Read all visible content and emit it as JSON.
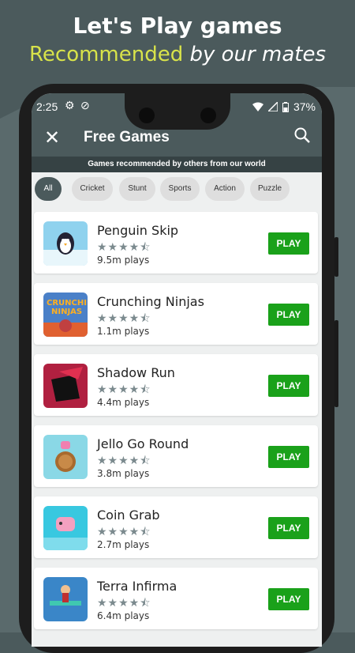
{
  "promo": {
    "line1": "Let's Play games",
    "line2_part1": "Recommended",
    "line2_part2": " by our mates"
  },
  "status_bar": {
    "time": "2:25",
    "battery": "37%",
    "icons": [
      "settings-gear-icon",
      "sync-icon",
      "wifi-icon",
      "signal-icon",
      "battery-icon"
    ]
  },
  "app_bar": {
    "title": "Free Games",
    "close_icon": "close-icon",
    "search_icon": "search-icon"
  },
  "subtitle": "Games recommended by others from our world",
  "categories": [
    "All",
    "Cricket",
    "Stunt",
    "Sports",
    "Action",
    "Puzzle"
  ],
  "selected_category": "All",
  "play_label": "PLAY",
  "games": [
    {
      "name": "Penguin Skip",
      "rating": 4.5,
      "plays": "9.5m plays"
    },
    {
      "name": "Crunching Ninjas",
      "rating": 4.5,
      "plays": "1.1m plays"
    },
    {
      "name": "Shadow Run",
      "rating": 4.5,
      "plays": "4.4m plays"
    },
    {
      "name": "Jello Go Round",
      "rating": 4.5,
      "plays": "3.8m plays"
    },
    {
      "name": "Coin Grab",
      "rating": 4.5,
      "plays": "2.7m plays"
    },
    {
      "name": "Terra Infirma",
      "rating": 4.5,
      "plays": "6.4m plays"
    }
  ],
  "colors": {
    "brand": "#4b5a5c",
    "accent_yellow": "#d8e34a",
    "play_green": "#1aa11a",
    "subbar": "#364244"
  }
}
